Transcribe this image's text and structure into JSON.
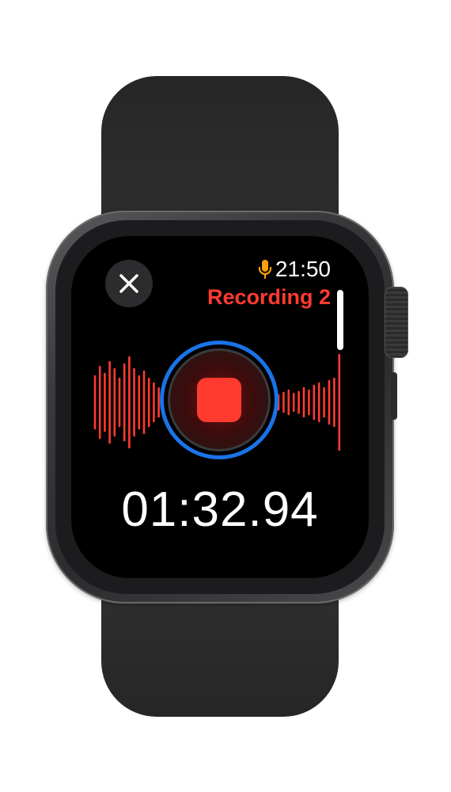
{
  "status": {
    "time": "21:50",
    "mic_icon": "microphone-icon",
    "mic_color": "#ff9f0a"
  },
  "recording": {
    "title": "Recording 2",
    "elapsed": "01:32.94",
    "state": "recording"
  },
  "controls": {
    "close_icon": "close-icon",
    "stop_icon": "stop-icon"
  },
  "colors": {
    "accent_red": "#ff3b30",
    "ring_blue": "#1a73e8",
    "background": "#000000"
  },
  "waveform": {
    "left_levels": [
      0.55,
      0.75,
      0.6,
      0.85,
      0.7,
      0.5,
      0.8,
      0.95,
      0.7,
      0.55,
      0.65,
      0.5,
      0.4,
      0.3
    ],
    "right_levels": [
      0.15,
      0.2,
      0.25,
      0.18,
      0.22,
      0.3,
      0.25,
      0.35,
      0.4,
      0.3,
      0.45,
      0.5,
      1.0
    ]
  }
}
